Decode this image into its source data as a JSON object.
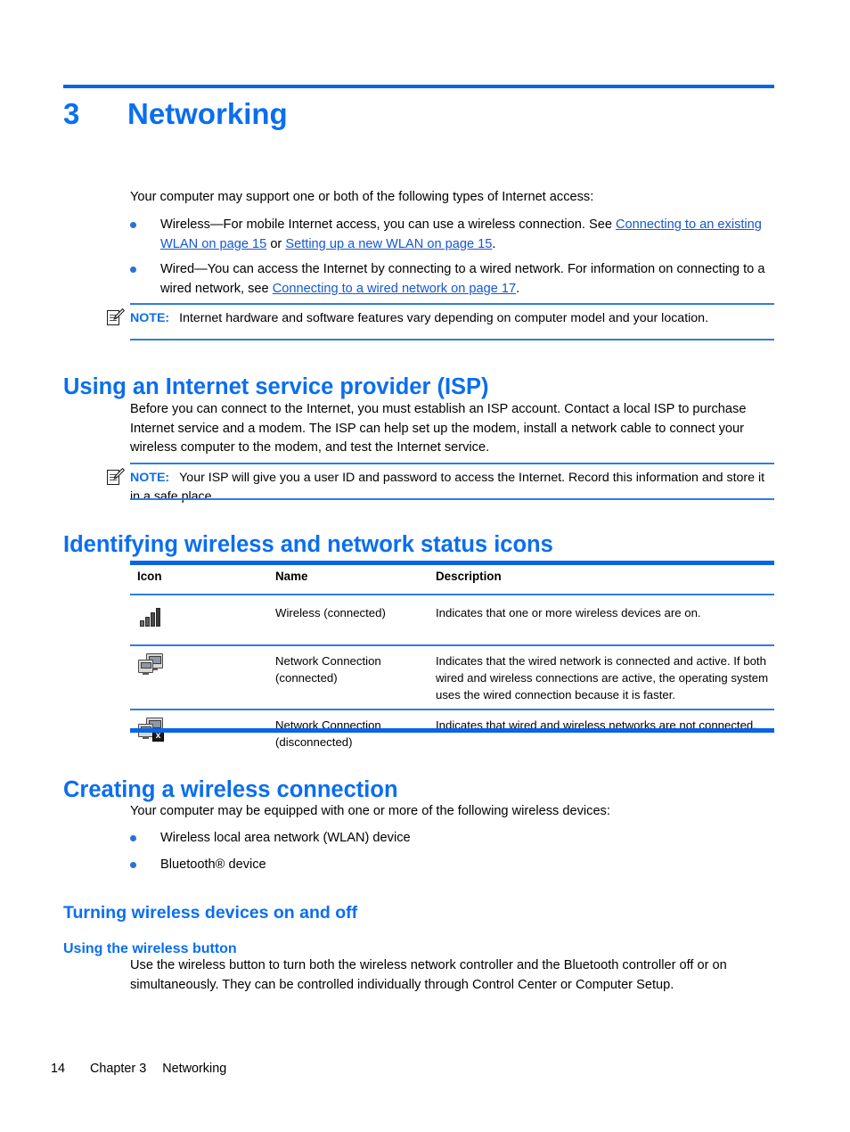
{
  "chapter": {
    "number": "3",
    "title": "Networking"
  },
  "intro": {
    "lead": "Your computer may support one or both of the following types of Internet access:",
    "bullets": [
      {
        "pre": "Wireless—For mobile Internet access, you can use a wireless connection. See ",
        "link1": "Connecting to an existing WLAN on page 15",
        "mid": " or ",
        "link2": "Setting up a new WLAN on page 15",
        "post": "."
      },
      {
        "pre": "Wired—You can access the Internet by connecting to a wired network. For information on connecting to a wired network, see ",
        "link1": "Connecting to a wired network on page 17",
        "post": "."
      }
    ],
    "note": {
      "label": "NOTE:",
      "text": "Internet hardware and software features vary depending on computer model and your location.",
      "icon": "note-pencil-icon"
    }
  },
  "isp": {
    "heading": "Using an Internet service provider (ISP)",
    "paragraph": "Before you can connect to the Internet, you must establish an ISP account. Contact a local ISP to purchase Internet service and a modem. The ISP can help set up the modem, install a network cable to connect your wireless computer to the modem, and test the Internet service.",
    "note": {
      "label": "NOTE:",
      "text": "Your ISP will give you a user ID and password to access the Internet. Record this information and store it in a safe place.",
      "icon": "note-pencil-icon"
    }
  },
  "icons_section": {
    "heading": "Identifying wireless and network status icons",
    "table": {
      "headers": [
        "Icon",
        "Name",
        "Description"
      ],
      "rows": [
        {
          "icon": "wireless-signal-bars-icon",
          "name": "Wireless (connected)",
          "description": "Indicates that one or more wireless devices are on."
        },
        {
          "icon": "network-connection-icon",
          "name": "Network Connection\n(connected)",
          "name_line1": "Network Connection",
          "name_line2": "(connected)",
          "description": "Indicates that the wired network is connected and active. If both wired and wireless connections are active, the operating system uses the wired connection because it is faster."
        },
        {
          "icon": "network-connection-disconnected-icon",
          "name_line1": "Network Connection",
          "name_line2": "(disconnected)",
          "description": "Indicates that wired and wireless networks are not connected."
        }
      ]
    }
  },
  "wireless_connection": {
    "heading": "Creating a wireless connection",
    "paragraph": "Your computer may be equipped with one or more of the following wireless devices:",
    "bullets": [
      "Wireless local area network (WLAN) device",
      "Bluetooth® device"
    ]
  },
  "turning": {
    "heading": "Turning wireless devices on and off",
    "subheading": "Using the wireless button",
    "paragraph": "Use the wireless button to turn both the wireless network controller and the Bluetooth controller off or on simultaneously. They can be controlled individually through Control Center or Computer Setup."
  },
  "footer": {
    "page": "14",
    "chapter": "Chapter 3",
    "title": "Networking"
  },
  "colors": {
    "heading_blue": "#0a6ef0",
    "rule_blue": "#0a64e6",
    "link_blue": "#1357d8",
    "text_black": "#000000"
  }
}
